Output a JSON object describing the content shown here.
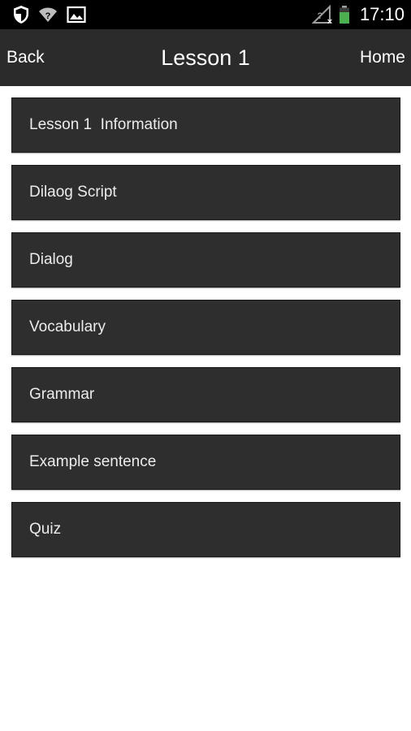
{
  "status_bar": {
    "time": "17:10",
    "left_icons": [
      "shield-icon",
      "wifi-question-icon",
      "image-icon"
    ],
    "right_icons": [
      "no-sim-icon",
      "battery-icon"
    ],
    "battery_color": "#4caf50"
  },
  "action_bar": {
    "back_label": "Back",
    "title": "Lesson 1",
    "home_label": "Home"
  },
  "menu": {
    "items": [
      {
        "label": "Lesson 1  Information"
      },
      {
        "label": "Dilaog Script"
      },
      {
        "label": "Dialog"
      },
      {
        "label": "Vocabulary"
      },
      {
        "label": "Grammar"
      },
      {
        "label": "Example sentence"
      },
      {
        "label": "Quiz"
      }
    ]
  },
  "colors": {
    "status_bar_bg": "#000000",
    "action_bar_bg": "#2b2b2b",
    "menu_item_bg": "#2e2e2e",
    "page_bg": "#ffffff"
  }
}
